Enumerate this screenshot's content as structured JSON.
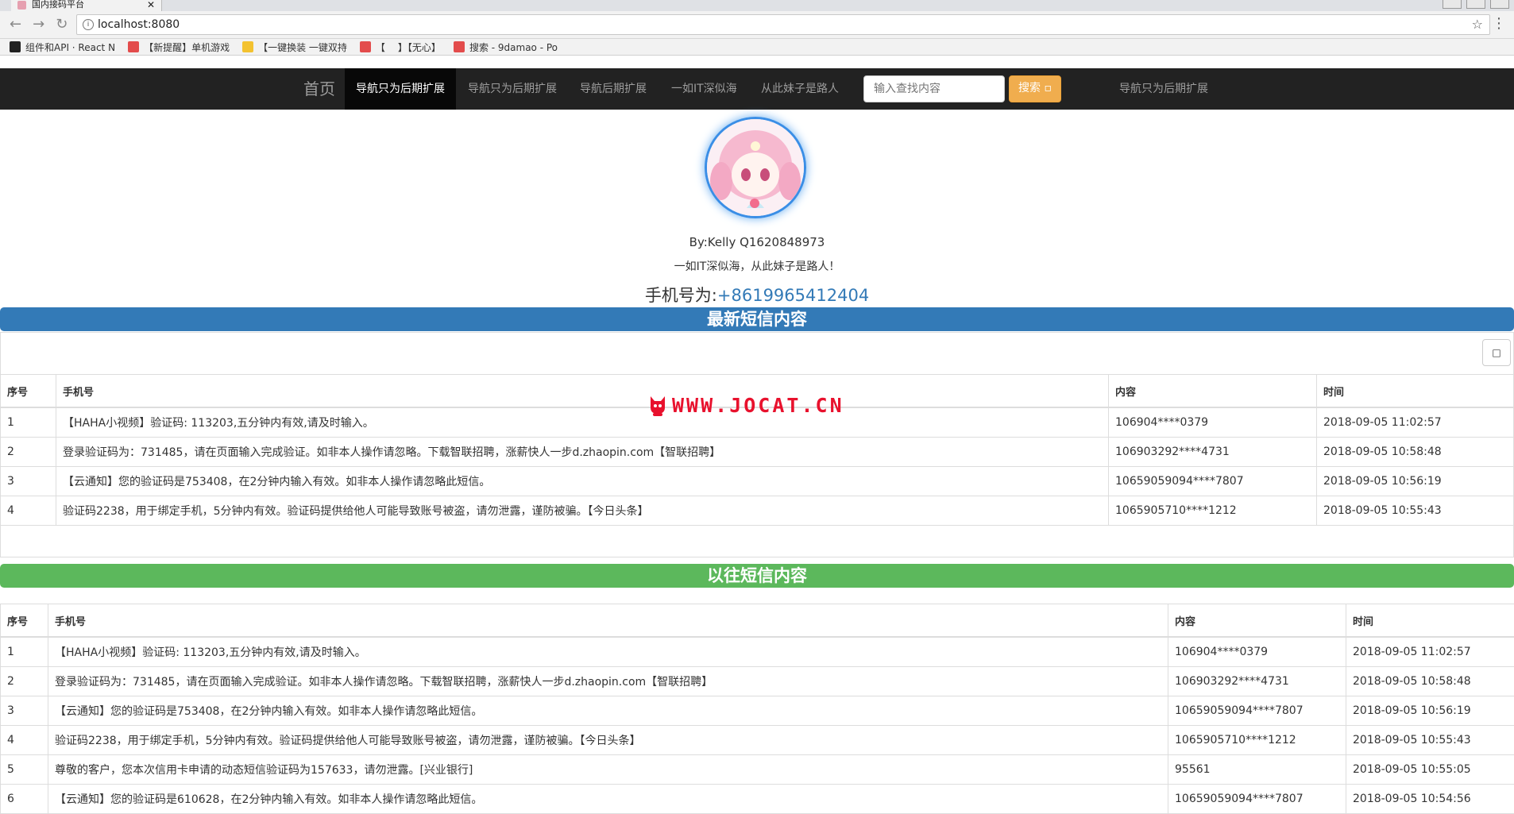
{
  "browser": {
    "tab_title": "国内接码平台",
    "url": "localhost:8080",
    "bookmarks": [
      "组件和API · React N",
      "【新提醒】单机游戏",
      "【一键换装 一键双持",
      "【",
      "】【无心】",
      "搜索 - 9damao - Po"
    ]
  },
  "navbar": {
    "brand": "首页",
    "items": [
      "导航只为后期扩展",
      "导航只为后期扩展",
      "导航后期扩展",
      "一如IT深似海",
      "从此妹子是路人"
    ],
    "search_placeholder": "输入查找内容",
    "search_button": "搜索",
    "right_item": "导航只为后期扩展"
  },
  "profile": {
    "byline": "By:Kelly Q1620848973",
    "motto": "一如IT深似海，从此妹子是路人！",
    "phone_label": "手机号为:",
    "phone_number": "+8619965412404"
  },
  "watermark": "WWW.JOCAT.CN",
  "latest": {
    "title": "最新短信内容",
    "columns": [
      "序号",
      "手机号",
      "内容",
      "时间"
    ],
    "rows": [
      [
        "1",
        "【HAHA小视频】验证码: 113203,五分钟内有效,请及时输入。",
        "106904****0379",
        "2018-09-05 11:02:57"
      ],
      [
        "2",
        "登录验证码为：731485，请在页面输入完成验证。如非本人操作请忽略。下载智联招聘，涨薪快人一步d.zhaopin.com【智联招聘】",
        "106903292****4731",
        "2018-09-05 10:58:48"
      ],
      [
        "3",
        "【云通知】您的验证码是753408，在2分钟内输入有效。如非本人操作请忽略此短信。",
        "10659059094****7807",
        "2018-09-05 10:56:19"
      ],
      [
        "4",
        "验证码2238，用于绑定手机，5分钟内有效。验证码提供给他人可能导致账号被盗，请勿泄露，谨防被骗。【今日头条】",
        "1065905710****1212",
        "2018-09-05 10:55:43"
      ]
    ]
  },
  "history": {
    "title": "以往短信内容",
    "columns": [
      "序号",
      "手机号",
      "内容",
      "时间"
    ],
    "rows": [
      [
        "1",
        "【HAHA小视频】验证码: 113203,五分钟内有效,请及时输入。",
        "106904****0379",
        "2018-09-05 11:02:57"
      ],
      [
        "2",
        "登录验证码为：731485，请在页面输入完成验证。如非本人操作请忽略。下载智联招聘，涨薪快人一步d.zhaopin.com【智联招聘】",
        "106903292****4731",
        "2018-09-05 10:58:48"
      ],
      [
        "3",
        "【云通知】您的验证码是753408，在2分钟内输入有效。如非本人操作请忽略此短信。",
        "10659059094****7807",
        "2018-09-05 10:56:19"
      ],
      [
        "4",
        "验证码2238，用于绑定手机，5分钟内有效。验证码提供给他人可能导致账号被盗，请勿泄露，谨防被骗。【今日头条】",
        "1065905710****1212",
        "2018-09-05 10:55:43"
      ],
      [
        "5",
        "尊敬的客户，您本次信用卡申请的动态短信验证码为157633，请勿泄露。[兴业银行]",
        "95561",
        "2018-09-05 10:55:05"
      ],
      [
        "6",
        "【云通知】您的验证码是610628，在2分钟内输入有效。如非本人操作请忽略此短信。",
        "10659059094****7807",
        "2018-09-05 10:54:56"
      ]
    ]
  }
}
